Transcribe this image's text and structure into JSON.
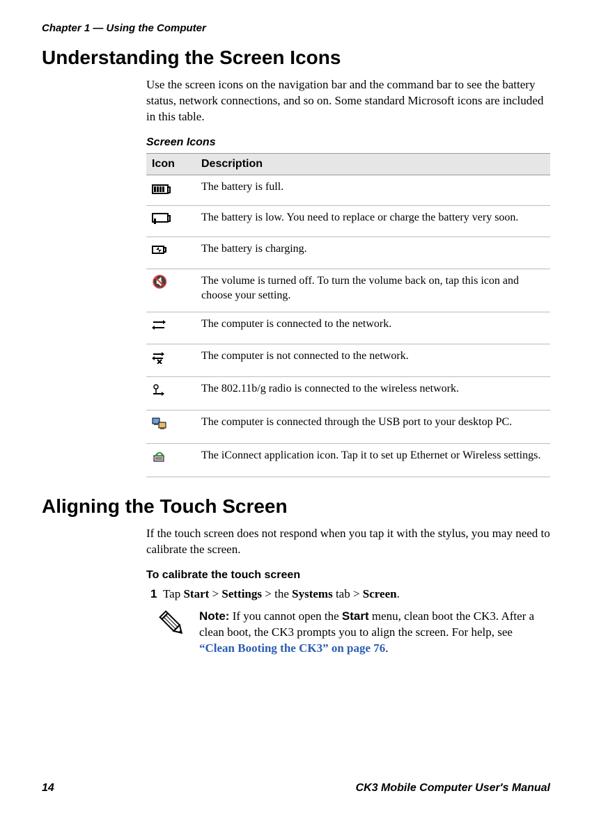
{
  "header": {
    "chapter": "Chapter 1 — Using the Computer"
  },
  "section1": {
    "title": "Understanding the Screen Icons",
    "intro": "Use the screen icons on the navigation bar and the command bar to see the battery status, network connections, and so on. Some standard Microsoft icons are included in this table.",
    "table_title": "Screen Icons",
    "col_icon": "Icon",
    "col_desc": "Description",
    "rows": [
      {
        "desc": "The battery is full."
      },
      {
        "desc": "The battery is low. You need to replace or charge the battery very soon."
      },
      {
        "desc": "The battery is charging."
      },
      {
        "desc": "The volume is turned off. To turn the volume back on, tap this icon and choose your setting."
      },
      {
        "desc": "The computer is connected to the network."
      },
      {
        "desc": "The computer is not connected to the network."
      },
      {
        "desc": "The 802.11b/g radio is connected to the wireless network."
      },
      {
        "desc": "The computer is connected through the USB port to your desktop PC."
      },
      {
        "desc": "The iConnect application icon. Tap it to set up Ethernet or Wireless settings."
      }
    ]
  },
  "section2": {
    "title": "Aligning the Touch Screen",
    "intro": "If the touch screen does not respond when you tap it with the stylus, you may need to calibrate the screen.",
    "subhead": "To calibrate the touch screen",
    "step1_num": "1",
    "step1_a": "Tap ",
    "step1_b": "Start",
    "step1_c": " > ",
    "step1_d": "Settings",
    "step1_e": " > the ",
    "step1_f": "Systems",
    "step1_g": " tab > ",
    "step1_h": "Screen",
    "step1_i": ".",
    "note_label": "Note:",
    "note_a": " If you cannot open the ",
    "note_b": "Start",
    "note_c": " menu, clean boot the CK3. After a clean boot, the CK3 prompts you to align the screen. For help, see ",
    "note_xref": "“Clean Booting the CK3” on page 76",
    "note_end": "."
  },
  "footer": {
    "page": "14",
    "manual": "CK3 Mobile Computer User's Manual"
  }
}
